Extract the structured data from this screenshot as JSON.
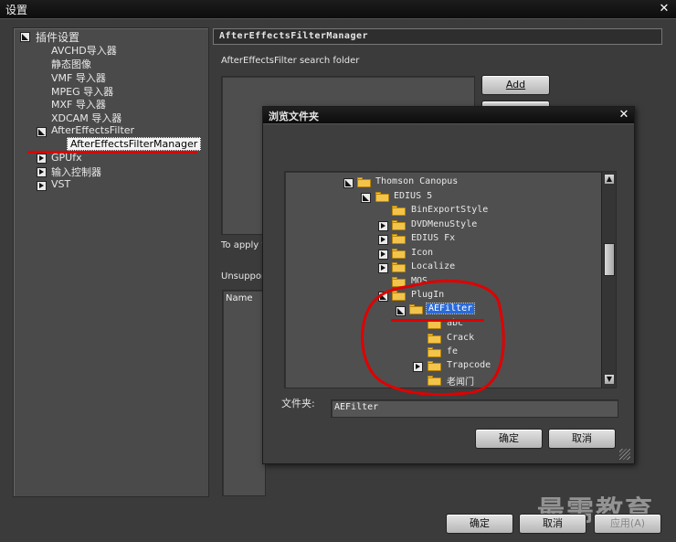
{
  "window": {
    "title": "设置",
    "close_glyph": "✕"
  },
  "left_tree": {
    "root": "插件设置",
    "items": [
      "AVCHD导入器",
      "静态图像",
      "VMF 导入器",
      "MPEG 导入器",
      "MXF 导入器",
      "XDCAM 导入器",
      "AfterEffectsFilter"
    ],
    "selected_child": "AfterEffectsFilterManager",
    "after": [
      "GPUfx",
      "输入控制器",
      "VST"
    ]
  },
  "right_panel": {
    "header": "AfterEffectsFilterManager",
    "search_folder_label": "AfterEffectsFilter search folder",
    "add_button": "Add",
    "apply_label": "To apply t",
    "unsupported_label": "Unsupport",
    "name_column": "Name"
  },
  "browse_dialog": {
    "title": "浏览文件夹",
    "close_glyph": "✕",
    "tree": [
      "Thomson Canopus",
      "EDIUS 5",
      "BinExportStyle",
      "DVDMenuStyle",
      "EDIUS Fx",
      "Icon",
      "Localize",
      "MOS",
      "PlugIn",
      "AEFilter",
      "abc",
      "Crack",
      "fe",
      "Trapcode",
      "老闻门"
    ],
    "folder_label": "文件夹:",
    "folder_value": "AEFilter",
    "ok_button": "确定",
    "cancel_button": "取消"
  },
  "footer": {
    "ok_button": "确定",
    "cancel_button": "取消",
    "apply_button": "应用(A)"
  },
  "watermark": "最需教育",
  "annotation_color": "#e00000"
}
